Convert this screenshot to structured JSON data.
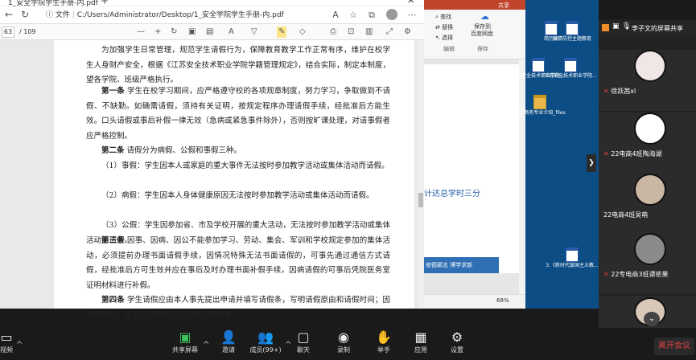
{
  "browser": {
    "tab_title": "1_安全学院学生手册-内.pdf",
    "url_prefix": "文件",
    "url": "C:/Users/Administrator/Desktop/1_安全学院学生手册-内.pdf",
    "page_current": "63",
    "page_total": "/ 109"
  },
  "document": {
    "paragraphs": [
      {
        "lead": "",
        "text": "为加强学生日常管理，规范学生请假行为，保障教育教学工作正常有序，维护在校学生人身财产安全，根据《江苏安全技术职业学院学籍管理规定》，结合实际，制定本制度，望各学院、班级严格执行。"
      },
      {
        "lead": "第一条",
        "text": "学生在校学习期间，应严格遵守校的各项规章制度，努力学习，争取做到不请假、不缺勤。如确需请假，须持有关证明，按规定程序办理请假手续，经批准后方能生效。口头请假或事后补假一律无效（急病或紧急事件除外），否则按旷课处理，对请事假者应严格控制。"
      },
      {
        "lead": "第二条",
        "text": "请假分为病假、公假和事假三种。"
      },
      {
        "lead": "",
        "text": "（1）事假：学生因本人或家庭的重大事件无法按时参加教学活动或集体活动而请假。"
      },
      {
        "lead": "",
        "text": "（2）病假：学生因本人身体健康原因无法按时参加教学活动或集体活动而请假。"
      },
      {
        "lead": "",
        "text": "（3）公假：学生因参加省、市及学校开展的重大活动，无法按时参加教学活动或集体活动而请假。"
      },
      {
        "lead": "第三条",
        "text": "因事、因病、因公不能参加学习、劳动、集会、军训和学校规定参加的集体活动，必须提前办理书面请假手续，因情况特殊无法书面请假的，可事先通过通信方式请假，经批准后方可生效并应在事后及时办理书面补假手续，因病请假的可事后凭院医务室证明材料进行补假。"
      },
      {
        "lead": "第四条",
        "text": "学生请假应由本人事先提出申请并填写请假条，写明请假原由和请假时间；因病请假的，应当出具院医务室诊断证明或者"
      }
    ]
  },
  "word": {
    "share": "共享",
    "find": "查找",
    "replace": "替换",
    "select": "选择",
    "edit": "编辑",
    "save_to": "保存到",
    "baidu": "百度网盘",
    "save_group": "保存",
    "slide_text": "计达总学时三分",
    "band_text": "修德砺志  博学求新",
    "zoom": "68%"
  },
  "desktop": {
    "icons": [
      {
        "label": "简历表"
      },
      {
        "label": "疫情防控主题教育"
      },
      {
        "label": "江苏安全技术职业学院..."
      },
      {
        "label": "江苏安全技术职业学院..."
      },
      {
        "label": "电子商务专业介绍_files"
      },
      {
        "label": "3.《新时代爱国主义教..."
      }
    ]
  },
  "meeting": {
    "shared_by": "李子文的屏幕共享",
    "participants": [
      {
        "name": "徐跃茜xl"
      },
      {
        "name": "22电商4班陶海湖"
      },
      {
        "name": "22电商4班吴萌"
      },
      {
        "name": "22专电商3班谭依果"
      },
      {
        "name": ""
      }
    ],
    "toolbar": [
      {
        "label": "视频"
      },
      {
        "label": "共享屏幕"
      },
      {
        "label": "邀请"
      },
      {
        "label": "成员(99+)"
      },
      {
        "label": "聊天"
      },
      {
        "label": "录制"
      },
      {
        "label": "举手"
      },
      {
        "label": "应用"
      },
      {
        "label": "设置"
      }
    ],
    "leave": "离开会议"
  }
}
